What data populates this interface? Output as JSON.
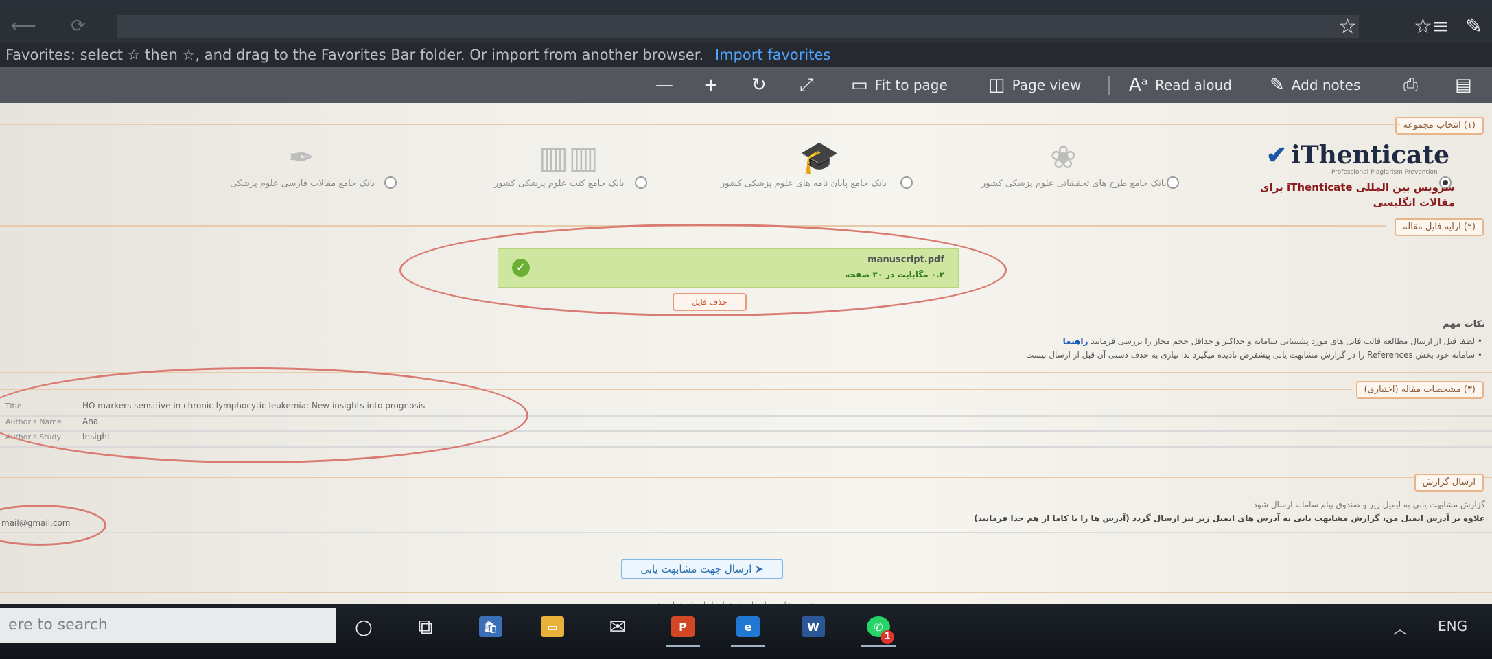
{
  "browser": {
    "favorites_bar_text": "Favorites: select ☆ then ☆, and drag to the Favorites Bar folder. Or import from another browser.",
    "import_link": "Import favorites"
  },
  "pdf_toolbar": {
    "zoom_out": "—",
    "zoom_in": "+",
    "fit_to_page": "Fit to page",
    "page_view": "Page view",
    "read_aloud": "Read aloud",
    "add_notes": "Add notes"
  },
  "sections": {
    "select_collection": "(۱) انتخاب مجموعه",
    "upload_file": "(۲) ارایه فایل مقاله",
    "article_specs": "(۳) مشخصات مقاله (اختیاری)",
    "send_report": "ارسال گزارش"
  },
  "services": {
    "ithenticate_brand": "iThenticate",
    "ithenticate_sub": "Professional Plagiarism Prevention",
    "ithenticate_label": "سرویس بین المللی iThenticate برای مقالات انگلیسی",
    "option2": "بانک جامع طرح های تحقیقاتی علوم پزشکی کشور",
    "option3": "بانک جامع پایان نامه های علوم پزشکی کشور",
    "option4": "بانک جامع کتب علوم پزشکی کشور",
    "option5": "بانک جامع مقالات فارسی علوم پزشکی"
  },
  "upload": {
    "file_name": "manuscript.pdf",
    "file_size": "۰.۲ مگابایت در ۳۰ صفحه",
    "delete_button": "حذف فایل"
  },
  "notes": {
    "title": "نکات مهم",
    "line1": "لطفا قبل از ارسال مطالعه قالب فایل های مورد پشتیبانی سامانه و حداکثر و حداقل حجم مجاز را بررسی فرمایید",
    "line1_link": "راهنما",
    "line2": "سامانه خود بخش References را در گزارش مشابهت یابی پیشفرض نادیده میگیرد لذا نیازی به حذف دستی آن قبل از ارسال نیست"
  },
  "metadata": {
    "title_label": "Title",
    "title_value": "HO markers sensitive in chronic lymphocytic leukemia: New insights into prognosis",
    "author_label": "Author's Name",
    "author_value": "Ana",
    "study_label": "Author's Study",
    "study_value": "Insight"
  },
  "report": {
    "line1": "گزارش مشابهت یابی به ایمیل زیر و صندوق پیام سامانه ارسال شود",
    "line2": "علاوه بر آدرس ایمیل من، گزارش مشابهت یابی به آدرس های ایمیل زیر نیز ارسال گردد (آدرس ها را با کاما از هم جدا فرمایید)",
    "email": "mail@gmail.com",
    "submit_button": "ارسال جهت مشابهت یابی",
    "footer": "نتیجه مشابهت یابی از طریق ایمیل ارسال خواهد شد"
  },
  "taskbar": {
    "search_placeholder": "ere to search",
    "whatsapp_badge": "1",
    "tray_lang": "ENG"
  },
  "colors": {
    "highlight_ellipse": "#d97b72",
    "upload_success": "#cfe6a0",
    "link_blue": "#4ea3ff"
  }
}
